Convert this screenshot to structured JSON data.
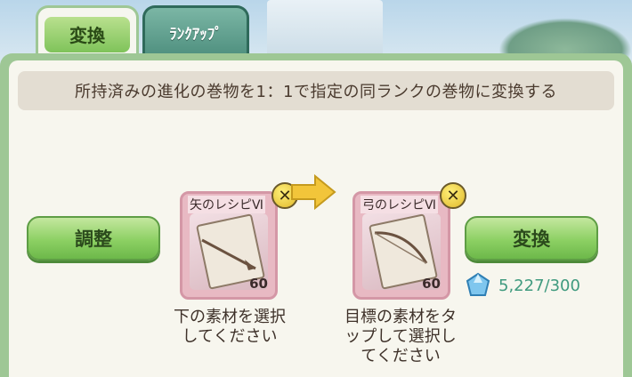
{
  "tabs": {
    "convert": "変換",
    "rankup": "ﾗﾝｸｱｯﾌﾟ"
  },
  "description": "所持済みの進化の巻物を1：1で指定の同ランクの巻物に変換する",
  "buttons": {
    "adjust": "調整",
    "convert": "変換"
  },
  "source_item": {
    "name": "矢のレシピⅥ",
    "qty": "60"
  },
  "target_item": {
    "name": "弓のレシピⅥ",
    "qty": "60"
  },
  "source_label": "下の素材を選択\nしてください",
  "target_label": "目標の素材をタ\nップして選択し\nてください",
  "cost": "5,227/300",
  "colors": {
    "accent_green": "#8cd063",
    "cost_text": "#3f9a7e",
    "item_frame": "#e8b9c3"
  },
  "icons": {
    "close": "close-icon",
    "arrow": "arrow-right-icon",
    "gem": "gem-icon"
  }
}
